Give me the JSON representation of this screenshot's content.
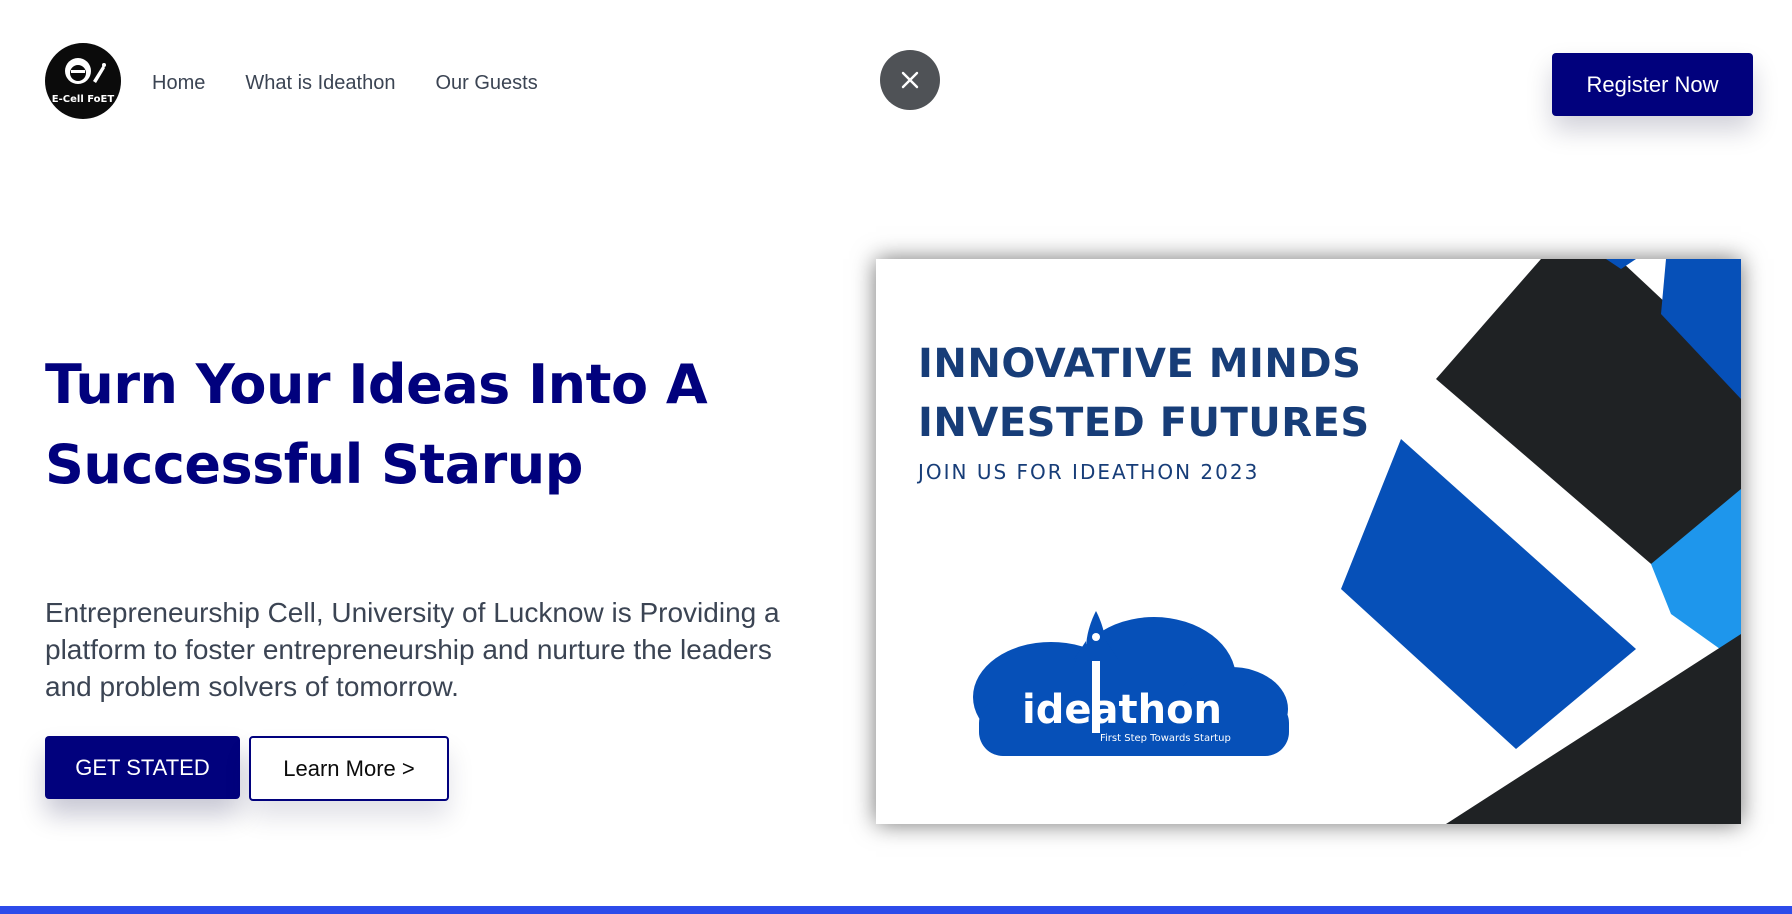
{
  "logo": {
    "text": "E-Cell FoET"
  },
  "nav": {
    "items": [
      "Home",
      "What is Ideathon",
      "Our Guests"
    ]
  },
  "header": {
    "register_label": "Register Now"
  },
  "hero": {
    "title": "Turn Your Ideas Into A Successful Starup",
    "description": "Entrepreneurship Cell, University of Lucknow is Providing a platform to foster entrepreneurship and nurture the leaders and problem solvers of tomorrow.",
    "cta_primary": "GET STATED",
    "cta_secondary": "Learn More >"
  },
  "poster": {
    "line1": "INNOVATIVE MINDS",
    "line2": "INVESTED FUTURES",
    "subline": "JOIN US FOR IDEATHON 2023",
    "logo_word": "ideathon",
    "tagline": "First Step Towards Startup"
  },
  "colors": {
    "brand_navy": "#01017d",
    "poster_blue": "#0650b8",
    "poster_dark": "#1f2224",
    "poster_light_blue": "#1e96ec",
    "bottom_bar": "#2d4bea"
  },
  "icons": {
    "close": "close-icon",
    "logo": "ecell-logo-icon",
    "rocket": "rocket-icon"
  }
}
